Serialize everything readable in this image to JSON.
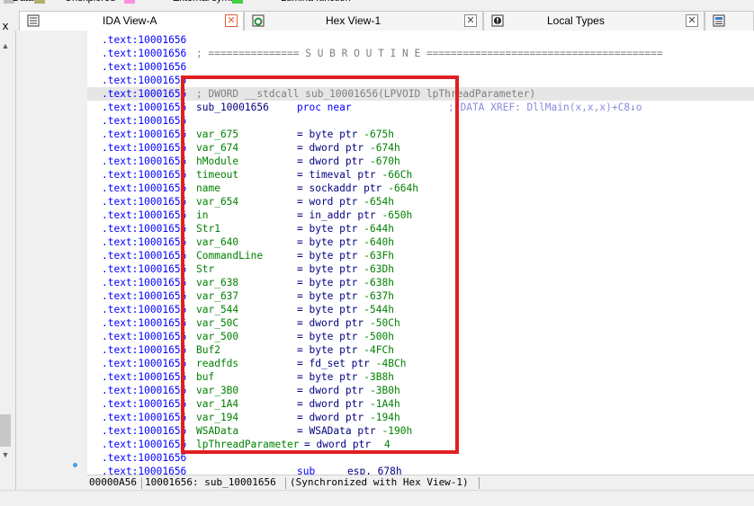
{
  "legend": [
    {
      "label": "Data",
      "color": "#c0c0c0"
    },
    {
      "label": "Unexplored",
      "color": "#b0b070"
    },
    {
      "label": "External symbol",
      "color": "#ff90e0"
    },
    {
      "label": "Lumina function",
      "color": "#40d040"
    }
  ],
  "left_close": "x",
  "tabs": [
    {
      "label": "IDA View-A",
      "icon": "ida-view-icon",
      "active": true
    },
    {
      "label": "Hex View-1",
      "icon": "hex-view-icon",
      "active": false
    },
    {
      "label": "Local Types",
      "icon": "local-types-icon",
      "active": false
    },
    {
      "label": "",
      "icon": "structures-icon",
      "active": false
    }
  ],
  "listing": {
    "header_lines": [
      {
        "addr": ".text:10001656",
        "text": ""
      },
      {
        "addr": ".text:10001656",
        "text": "; =============== S U B R O U T I N E ======================================="
      },
      {
        "addr": ".text:10001656",
        "text": ""
      },
      {
        "addr": ".text:10001656",
        "text": ""
      },
      {
        "addr": ".text:10001656",
        "text": "; DWORD __stdcall sub_10001656(LPVOID lpThreadParameter)"
      },
      {
        "addr": ".text:10001656",
        "name": "sub_10001656",
        "op": "proc near",
        "comment": "; DATA XREF: DllMain(x,x,x)+C8↓o"
      },
      {
        "addr": ".text:10001656",
        "text": ""
      }
    ],
    "vars": [
      {
        "addr": ".text:10001656",
        "name": "var_675",
        "type": "= byte ptr",
        "off": "-675h"
      },
      {
        "addr": ".text:10001656",
        "name": "var_674",
        "type": "= dword ptr",
        "off": "-674h"
      },
      {
        "addr": ".text:10001656",
        "name": "hModule",
        "type": "= dword ptr",
        "off": "-670h"
      },
      {
        "addr": ".text:10001656",
        "name": "timeout",
        "type": "= timeval ptr",
        "off": "-66Ch"
      },
      {
        "addr": ".text:10001656",
        "name": "name",
        "type": "= sockaddr ptr",
        "off": "-664h"
      },
      {
        "addr": ".text:10001656",
        "name": "var_654",
        "type": "= word ptr",
        "off": "-654h"
      },
      {
        "addr": ".text:10001656",
        "name": "in",
        "type": "= in_addr ptr",
        "off": "-650h"
      },
      {
        "addr": ".text:10001656",
        "name": "Str1",
        "type": "= byte ptr",
        "off": "-644h"
      },
      {
        "addr": ".text:10001656",
        "name": "var_640",
        "type": "= byte ptr",
        "off": "-640h"
      },
      {
        "addr": ".text:10001656",
        "name": "CommandLine",
        "type": "= byte ptr",
        "off": "-63Fh"
      },
      {
        "addr": ".text:10001656",
        "name": "Str",
        "type": "= byte ptr",
        "off": "-63Dh"
      },
      {
        "addr": ".text:10001656",
        "name": "var_638",
        "type": "= byte ptr",
        "off": "-638h"
      },
      {
        "addr": ".text:10001656",
        "name": "var_637",
        "type": "= byte ptr",
        "off": "-637h"
      },
      {
        "addr": ".text:10001656",
        "name": "var_544",
        "type": "= byte ptr",
        "off": "-544h"
      },
      {
        "addr": ".text:10001656",
        "name": "var_50C",
        "type": "= dword ptr",
        "off": "-50Ch"
      },
      {
        "addr": ".text:10001656",
        "name": "var_500",
        "type": "= byte ptr",
        "off": "-500h"
      },
      {
        "addr": ".text:10001656",
        "name": "Buf2",
        "type": "= byte ptr",
        "off": "-4FCh"
      },
      {
        "addr": ".text:10001656",
        "name": "readfds",
        "type": "= fd_set ptr",
        "off": "-4BCh"
      },
      {
        "addr": ".text:10001656",
        "name": "buf",
        "type": "= byte ptr",
        "off": "-3B8h"
      },
      {
        "addr": ".text:10001656",
        "name": "var_3B0",
        "type": "= dword ptr",
        "off": "-3B0h"
      },
      {
        "addr": ".text:10001656",
        "name": "var_1A4",
        "type": "= dword ptr",
        "off": "-1A4h"
      },
      {
        "addr": ".text:10001656",
        "name": "var_194",
        "type": "= dword ptr",
        "off": "-194h"
      },
      {
        "addr": ".text:10001656",
        "name": "WSAData",
        "type": "= WSAData ptr",
        "off": "-190h"
      },
      {
        "addr": ".text:10001656",
        "name": "lpThreadParameter",
        "type": "= dword ptr",
        "off": "4"
      }
    ],
    "tail_lines": [
      {
        "addr": ".text:10001656",
        "text": ""
      },
      {
        "addr": ".text:10001656",
        "mnem": "sub",
        "ops": "esp, 678h"
      }
    ]
  },
  "status": {
    "offset": "00000A56",
    "location": "10001656: sub_10001656",
    "sync": "(Synchronized with Hex View-1)"
  }
}
